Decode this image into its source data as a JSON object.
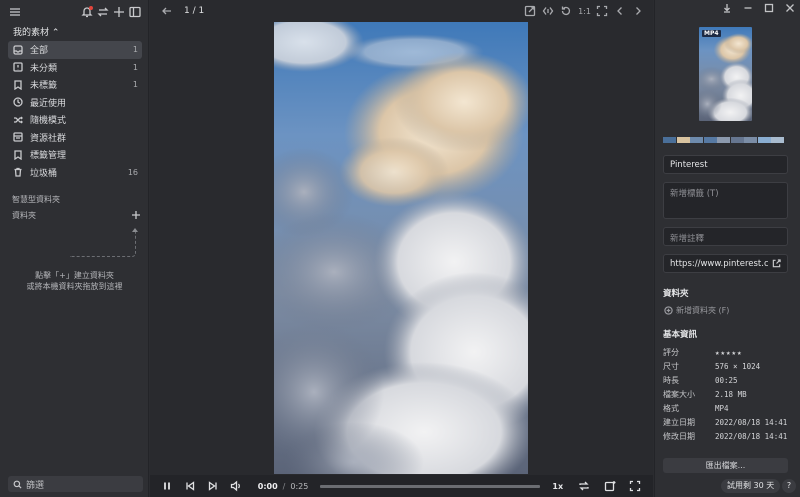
{
  "sidebar": {
    "library_title": "我的素材 ⌃",
    "items": [
      {
        "label": "全部",
        "count": "1",
        "icon": "inbox-icon",
        "active": true
      },
      {
        "label": "未分類",
        "count": "1",
        "icon": "unsorted-icon"
      },
      {
        "label": "未標籤",
        "count": "1",
        "icon": "untagged-icon"
      },
      {
        "label": "最近使用",
        "count": "",
        "icon": "clock-icon"
      },
      {
        "label": "隨機模式",
        "count": "",
        "icon": "shuffle-icon"
      },
      {
        "label": "資源社群",
        "count": "",
        "icon": "community-icon"
      },
      {
        "label": "標籤管理",
        "count": "",
        "icon": "tag-manage-icon"
      },
      {
        "label": "垃圾桶",
        "count": "16",
        "icon": "trash-icon"
      }
    ],
    "smart_folders_title": "智慧型資料夾",
    "folders_title": "資料夾",
    "hint_line1": "點擊「+」建立資料夾",
    "hint_line2": "或將本機資料夾拖放到這裡",
    "filter_placeholder": "篩選"
  },
  "viewer": {
    "page_indicator": "1 / 1",
    "zoom_label": "1:1",
    "time_current": "0:00",
    "time_separator": "/",
    "time_total": "0:25",
    "progress": 0.0,
    "speed_label": "1x"
  },
  "panel": {
    "thumb_badge": "MP4",
    "palette": [
      "#4a6f99",
      "#d8c3a0",
      "#6e8bad",
      "#5679a3",
      "#8c9aae",
      "#667690",
      "#7b8da6",
      "#8aaed2",
      "#a9bccf"
    ],
    "name": "Pinterest",
    "tags_placeholder": "新增標籤 (T)",
    "note_placeholder": "新增註釋",
    "url": "https://www.pinterest.com/p",
    "folders_title": "資料夾",
    "new_folder_label": "新增資料夾 (F)",
    "basic_title": "基本資訊",
    "info": [
      {
        "key": "評分",
        "value": "★★★★★"
      },
      {
        "key": "尺寸",
        "value": "576 × 1024"
      },
      {
        "key": "時長",
        "value": "00:25"
      },
      {
        "key": "檔案大小",
        "value": "2.18 MB"
      },
      {
        "key": "格式",
        "value": "MP4"
      },
      {
        "key": "建立日期",
        "value": "2022/08/18 14:41"
      },
      {
        "key": "修改日期",
        "value": "2022/08/18 14:41"
      }
    ],
    "rating": 0,
    "export_label": "匯出檔案...",
    "trial_label": "試用剩 30 天",
    "help_label": "?"
  }
}
